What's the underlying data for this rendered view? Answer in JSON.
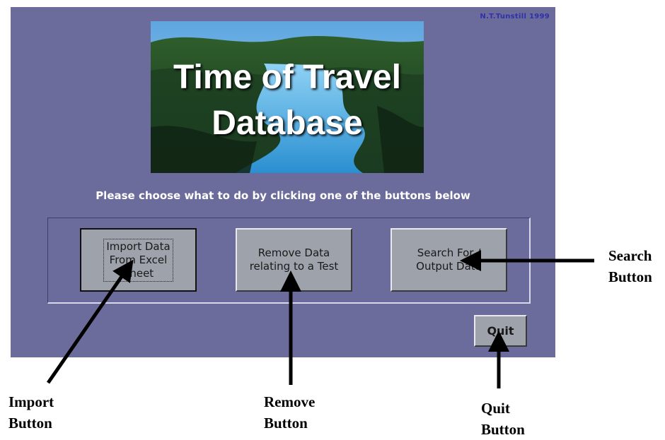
{
  "app": {
    "credit": "N.T.Tunstill 1999",
    "banner_title_line1": "Time of Travel",
    "banner_title_line2": "Database",
    "instruction": "Please choose what to do by clicking one of the buttons below"
  },
  "buttons": {
    "import": "Import Data\nFrom Excel\nSheet",
    "remove": "Remove Data\nrelating to a Test",
    "search": "Search For /\nOutput Data",
    "quit": "Quit"
  },
  "callouts": {
    "search": "Search\nButton",
    "import": "Import\nButton",
    "remove": "Remove\nButton",
    "quit": "Quit\nButton"
  },
  "colors": {
    "screen_bg": "#6b6b9c",
    "button_face": "#9ea2ab",
    "credit_text": "#3030a8"
  }
}
